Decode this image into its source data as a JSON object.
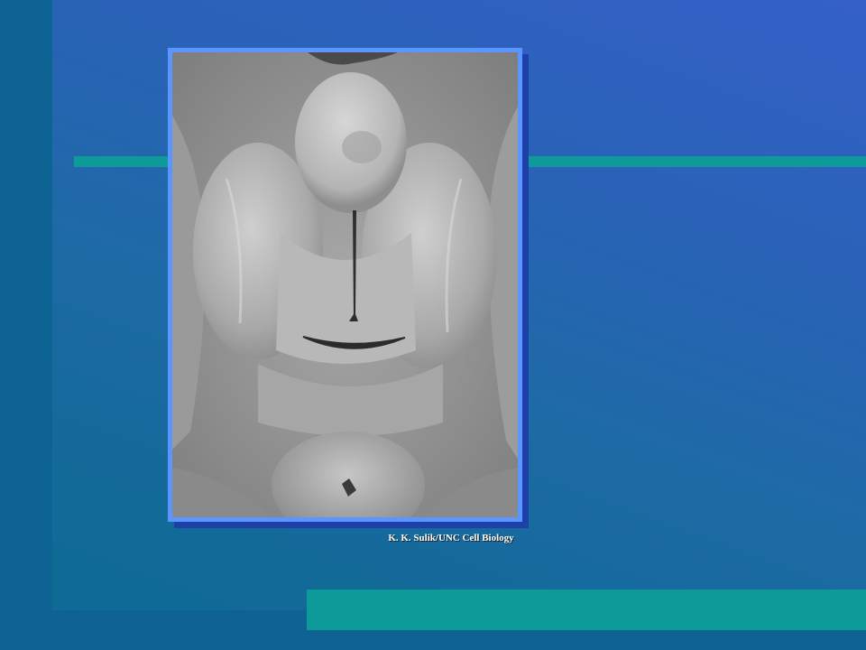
{
  "slide": {
    "background_colors": [
      "#3460c8",
      "#1e6aa6",
      "#0e6b94"
    ],
    "accent_color": "#0f9a9a",
    "frame_color": "#5b95ff"
  },
  "photo": {
    "icon": "sem-micrograph-image"
  },
  "credit": {
    "text": "K. K. Sulik/UNC Cell Biology"
  }
}
